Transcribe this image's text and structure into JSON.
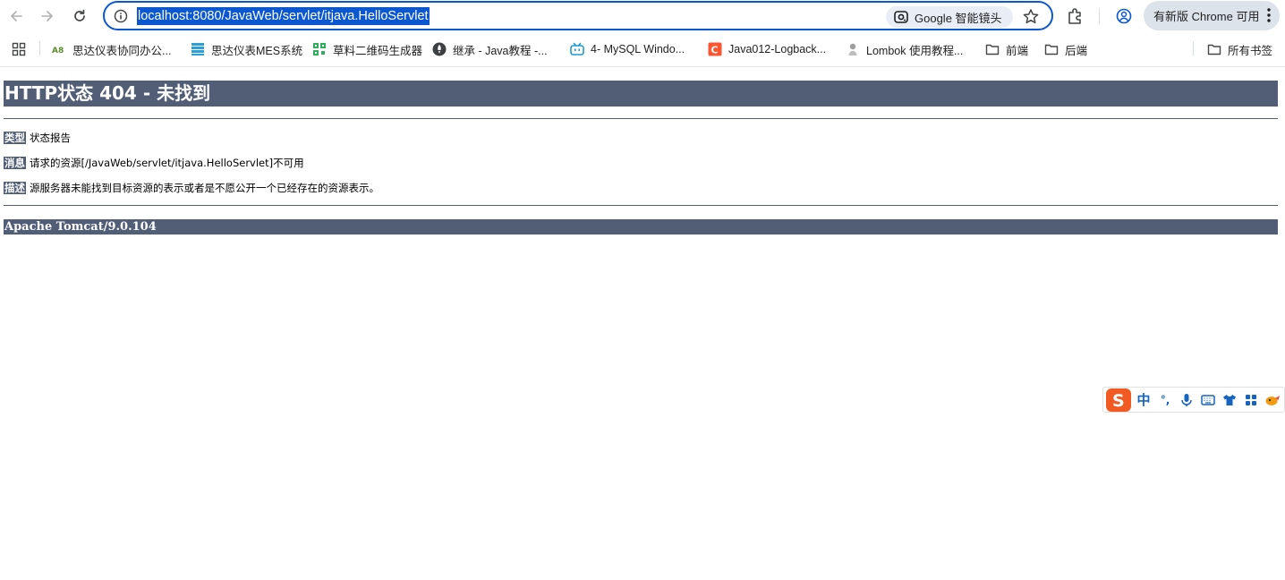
{
  "browser": {
    "url": "localhost:8080/JavaWeb/servlet/itjava.HelloServlet",
    "lens_label": "Google 智能镜头",
    "update_label": "有新版 Chrome 可用"
  },
  "bookmarks": {
    "items": [
      {
        "label": "思达仪表协同办公...",
        "icon": "ab-favicon"
      },
      {
        "label": "思达仪表MES系统",
        "icon": "stars-favicon"
      },
      {
        "label": "草料二维码生成器",
        "icon": "qrcode-favicon"
      },
      {
        "label": "继承 - Java教程 -...",
        "icon": "rocket-favicon"
      },
      {
        "label": "4- MySQL Windo...",
        "icon": "bilibili-favicon"
      },
      {
        "label": "Java012-Logback...",
        "icon": "csdn-favicon"
      },
      {
        "label": "Lombok 使用教程...",
        "icon": "lombok-favicon"
      },
      {
        "label": "前端",
        "icon": "folder-icon"
      },
      {
        "label": "后端",
        "icon": "folder-icon"
      }
    ],
    "all_bookmarks_label": "所有书签"
  },
  "page": {
    "title": "HTTP状态 404 - 未找到",
    "type_label": "类型",
    "type_value": "状态报告",
    "message_label": "消息",
    "message_value": "请求的资源[/JavaWeb/servlet/itjava.HelloServlet]不可用",
    "description_label": "描述",
    "description_value": "源服务器未能找到目标资源的表示或者是不愿公开一个已经存在的资源表示。",
    "footer": "Apache Tomcat/9.0.104"
  },
  "ime": {
    "logo": "S",
    "mode_label": "中",
    "punct_label": "°,"
  },
  "colors": {
    "tomcat_bar": "#525d76",
    "omnibox_border": "#0b57d0",
    "ime_blue": "#1565c0",
    "ime_logo": "#f15a22"
  }
}
